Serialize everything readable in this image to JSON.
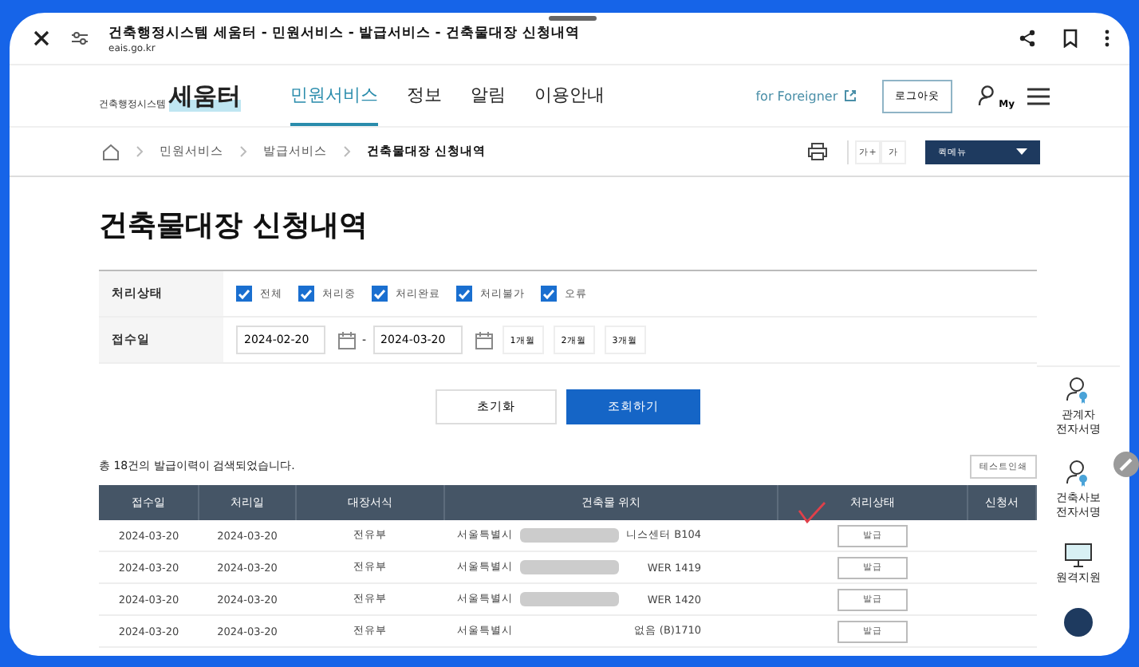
{
  "browser": {
    "title": "건축행정시스템 세움터 - 민원서비스 - 발급서비스 - 건축물대장 신청내역",
    "url": "eais.go.kr"
  },
  "header": {
    "logo_sub": "건축행정시스템",
    "logo": "세움터",
    "nav": [
      {
        "label": "민원서비스",
        "selected": true
      },
      {
        "label": "정보",
        "selected": false
      },
      {
        "label": "알림",
        "selected": false
      },
      {
        "label": "이용안내",
        "selected": false
      }
    ],
    "foreigner_link": "for Foreigner",
    "logout": "로그아웃",
    "my": "My"
  },
  "breadcrumb": {
    "items": [
      "민원서비스",
      "발급서비스"
    ],
    "current": "건축물대장 신청내역",
    "font_buttons": [
      "가+",
      "가"
    ],
    "quick_menu": "퀵메뉴"
  },
  "title": "건축물대장 신청내역",
  "filter": {
    "status_label": "처리상태",
    "statuses": [
      {
        "label": "전체",
        "checked": true
      },
      {
        "label": "처리중",
        "checked": true
      },
      {
        "label": "처리완료",
        "checked": true
      },
      {
        "label": "처리불가",
        "checked": true
      },
      {
        "label": "오류",
        "checked": true
      }
    ],
    "date_label": "접수일",
    "date_from": "2024-02-20",
    "date_sep": "-",
    "date_to": "2024-03-20",
    "periods": [
      "1개월",
      "2개월",
      "3개월"
    ]
  },
  "buttons": {
    "reset": "초기화",
    "search": "조회하기"
  },
  "result_count": "총 18건의 발급이력이 검색되었습니다.",
  "test_print": "테스트인쇄",
  "table": {
    "columns": [
      "접수일",
      "처리일",
      "대장서식",
      "건축물 위치",
      "처리상태",
      "신청서"
    ],
    "rows": [
      {
        "received": "2024-03-20",
        "processed": "2024-03-20",
        "form": "전유부",
        "location_start": "서울특별시",
        "redacted": true,
        "location_end": "니스센터 B104",
        "status": "발급"
      },
      {
        "received": "2024-03-20",
        "processed": "2024-03-20",
        "form": "전유부",
        "location_start": "서울특별시",
        "redacted": true,
        "location_end": "WER 1419",
        "status": "발급"
      },
      {
        "received": "2024-03-20",
        "processed": "2024-03-20",
        "form": "전유부",
        "location_start": "서울특별시",
        "redacted": true,
        "location_end": "WER 1420",
        "status": "발급"
      },
      {
        "received": "2024-03-20",
        "processed": "2024-03-20",
        "form": "전유부",
        "location_start": "서울특별시",
        "redacted": false,
        "location_end": "없음 (B)1710",
        "status": "발급"
      }
    ]
  },
  "quick_side": [
    {
      "kind": "person",
      "label": "관계자 전자서명"
    },
    {
      "kind": "person",
      "label": "건축사보 전자서명"
    },
    {
      "kind": "monitor",
      "label": "원격지원"
    }
  ]
}
